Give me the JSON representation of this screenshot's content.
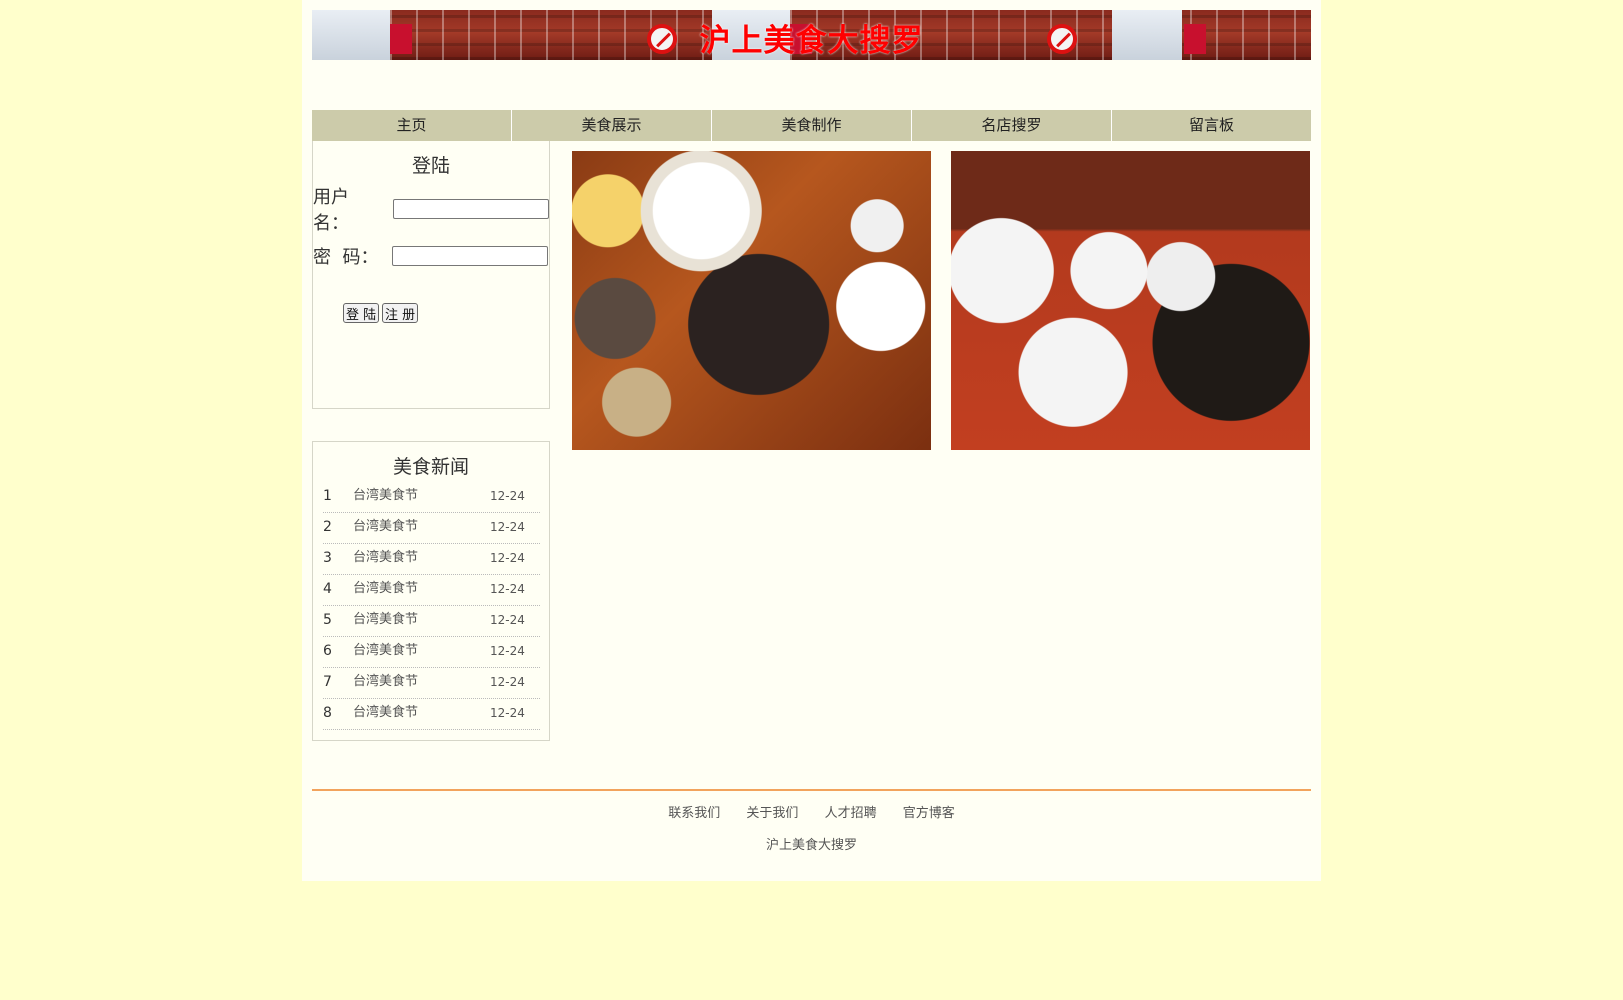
{
  "banner": {
    "title": "沪上美食大搜罗"
  },
  "nav": {
    "items": [
      "主页",
      "美食展示",
      "美食制作",
      "名店搜罗",
      "留言板"
    ]
  },
  "login": {
    "title": "登陆",
    "username_label": "用户名：",
    "password_label": "密  码：",
    "username_value": "",
    "password_value": "",
    "login_button": "登 陆",
    "register_button": "注 册"
  },
  "news": {
    "title": "美食新闻",
    "items": [
      {
        "num": "1",
        "title": "台湾美食节",
        "date": "12-24"
      },
      {
        "num": "2",
        "title": "台湾美食节",
        "date": "12-24"
      },
      {
        "num": "3",
        "title": "台湾美食节",
        "date": "12-24"
      },
      {
        "num": "4",
        "title": "台湾美食节",
        "date": "12-24"
      },
      {
        "num": "5",
        "title": "台湾美食节",
        "date": "12-24"
      },
      {
        "num": "6",
        "title": "台湾美食节",
        "date": "12-24"
      },
      {
        "num": "7",
        "title": "台湾美食节",
        "date": "12-24"
      },
      {
        "num": "8",
        "title": "台湾美食节",
        "date": "12-24"
      }
    ]
  },
  "footer": {
    "links": [
      "联系我们",
      "关于我们",
      "人才招聘",
      "官方博客"
    ],
    "copyright": "沪上美食大搜罗"
  },
  "colors": {
    "page_bg": "#ffffcc",
    "content_bg": "#fffff4",
    "nav_bg": "#cccbaa",
    "banner_title": "#ff0000",
    "footer_line": "#f2a35c"
  }
}
